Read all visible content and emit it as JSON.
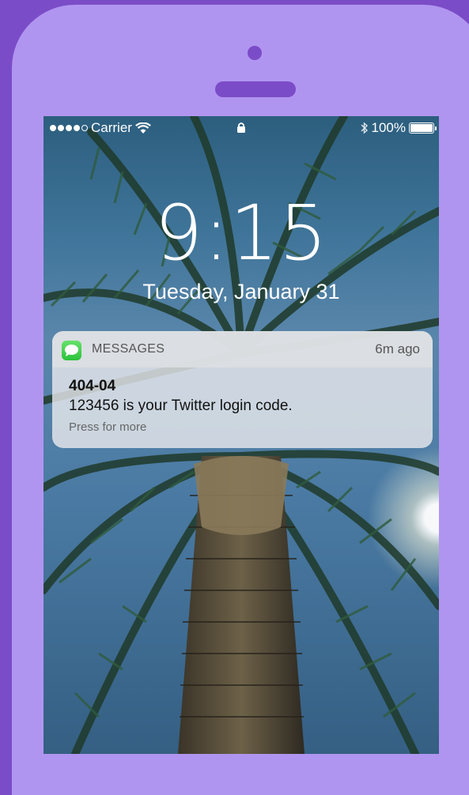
{
  "status_bar": {
    "carrier": "Carrier",
    "battery_percent": "100%"
  },
  "lock_screen": {
    "time": "9:15",
    "date": "Tuesday, January 31"
  },
  "notification": {
    "app_name": "MESSAGES",
    "time_ago": "6m ago",
    "sender": "404-04",
    "message": "123456 is your Twitter login code.",
    "hint": "Press for more"
  },
  "colors": {
    "background": "#7b4cc7",
    "phone_body": "#b095f0",
    "messages_icon": "#34c759"
  }
}
